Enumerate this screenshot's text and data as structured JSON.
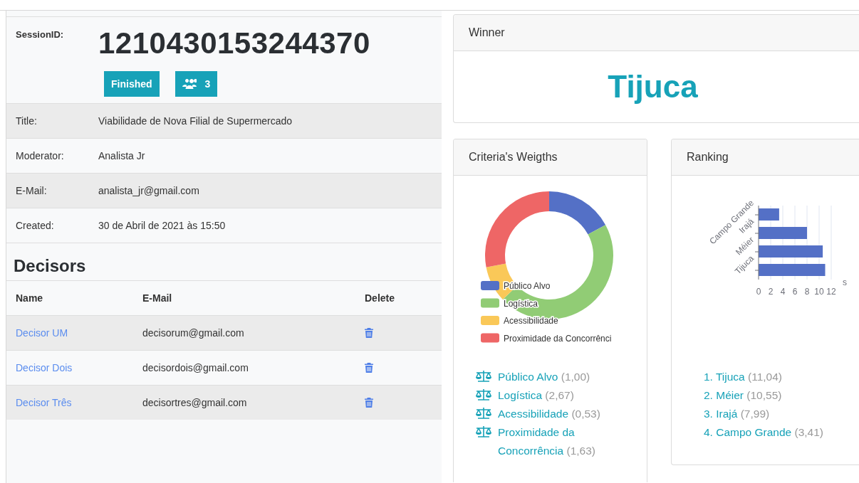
{
  "session": {
    "label": "SessionID:",
    "id": "1210430153244370",
    "status": "Finished",
    "participants": "3"
  },
  "details": [
    {
      "label": "Title:",
      "value": "Viabilidade de Nova Filial de Supermercado"
    },
    {
      "label": "Moderator:",
      "value": "Analista Jr"
    },
    {
      "label": "E-Mail:",
      "value": "analista_jr@gmail.com"
    },
    {
      "label": "Created:",
      "value": "30 de Abril de 2021 às 15:50"
    }
  ],
  "decisors": {
    "title": "Decisors",
    "columns": [
      "Name",
      "E-Mail",
      "Delete"
    ],
    "rows": [
      {
        "name": "Decisor UM",
        "email": "decisorum@gmail.com"
      },
      {
        "name": "Decisor Dois",
        "email": "decisordois@gmail.com"
      },
      {
        "name": "Decisor Três",
        "email": "decisortres@gmail.com"
      }
    ]
  },
  "winner": {
    "title": "Winner",
    "name": "Tijuca"
  },
  "weights": {
    "title": "Criteria's Weigths",
    "chart_data": {
      "type": "donut",
      "categories": [
        "Público Alvo",
        "Logística",
        "Acessibilidade",
        "Proximidade da Concorrênci"
      ],
      "values": [
        17.1,
        45.8,
        9.1,
        28.0
      ],
      "legend": "bottom-left"
    },
    "legend": [
      {
        "color": "#5470c6"
      },
      {
        "color": "#91cc75"
      },
      {
        "color": "#fac858"
      },
      {
        "color": "#ee6666"
      }
    ],
    "items": [
      {
        "name": "Público Alvo",
        "weight": "(1,00)"
      },
      {
        "name": "Logística",
        "weight": "(2,67)"
      },
      {
        "name": "Acessibilidade",
        "weight": "(0,53)"
      },
      {
        "name": "Proximidade da Concorrência",
        "weight": "(1,63)"
      }
    ]
  },
  "ranking": {
    "title": "Ranking",
    "chart_data": {
      "type": "bar",
      "orientation": "horizontal",
      "categories": [
        "Campo Grande",
        "Irajá",
        "Méier",
        "Tijuca"
      ],
      "values": [
        3.4,
        8.0,
        10.6,
        11.0
      ],
      "xlabel": "s",
      "xlim": [
        0,
        12
      ],
      "xticks": [
        0,
        2,
        4,
        6,
        8,
        10,
        12
      ],
      "grid": true
    },
    "items": [
      {
        "rank": "1.",
        "name": "Tijuca",
        "score": "(11,04)"
      },
      {
        "rank": "2.",
        "name": "Méier",
        "score": "(10,55)"
      },
      {
        "rank": "3.",
        "name": "Irajá",
        "score": "(7,99)"
      },
      {
        "rank": "4.",
        "name": "Campo Grande",
        "score": "(3,41)"
      }
    ]
  }
}
